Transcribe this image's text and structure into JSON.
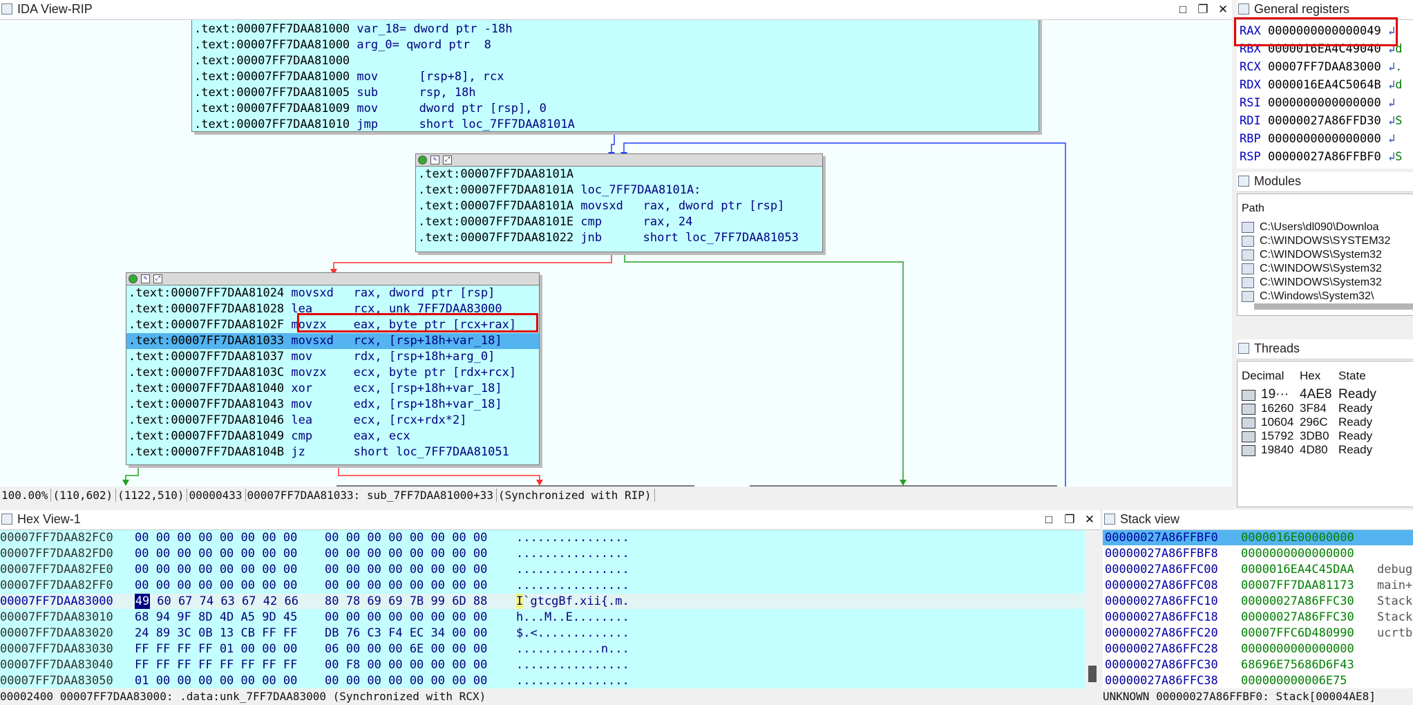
{
  "ida_view": {
    "title": "IDA View-RIP",
    "block_top": [
      {
        "addr": ".text:00007FF7DAA81000",
        "mn": "var_18=",
        "op": "dword ptr -18h"
      },
      {
        "addr": ".text:00007FF7DAA81000",
        "mn": "arg_0=",
        "op": "qword ptr  8"
      },
      {
        "addr": ".text:00007FF7DAA81000",
        "mn": "",
        "op": ""
      },
      {
        "addr": ".text:00007FF7DAA81000",
        "mn": "mov",
        "op": "[rsp+8], rcx"
      },
      {
        "addr": ".text:00007FF7DAA81005",
        "mn": "sub",
        "op": "rsp, 18h"
      },
      {
        "addr": ".text:00007FF7DAA81009",
        "mn": "mov",
        "op": "dword ptr [rsp], 0"
      },
      {
        "addr": ".text:00007FF7DAA81010",
        "mn": "jmp",
        "op": "short loc_7FF7DAA8101A"
      }
    ],
    "block_loop": [
      {
        "addr": ".text:00007FF7DAA8101A",
        "mn": "",
        "op": ""
      },
      {
        "addr": ".text:00007FF7DAA8101A",
        "mn": "loc_7FF7DAA8101A:",
        "op": ""
      },
      {
        "addr": ".text:00007FF7DAA8101A",
        "mn": "movsxd",
        "op": "rax, dword ptr [rsp]"
      },
      {
        "addr": ".text:00007FF7DAA8101E",
        "mn": "cmp",
        "op": "rax, 24"
      },
      {
        "addr": ".text:00007FF7DAA81022",
        "mn": "jnb",
        "op": "short loc_7FF7DAA81053"
      }
    ],
    "block_body": [
      {
        "addr": ".text:00007FF7DAA81024",
        "mn": "movsxd",
        "op": "rax, dword ptr [rsp]"
      },
      {
        "addr": ".text:00007FF7DAA81028",
        "mn": "lea",
        "op": "rcx, unk_7FF7DAA83000"
      },
      {
        "addr": ".text:00007FF7DAA8102F",
        "mn": "movzx",
        "op": "eax, byte ptr [rcx+rax]"
      },
      {
        "addr": ".text:00007FF7DAA81033",
        "mn": "movsxd",
        "op": "rcx, [rsp+18h+var_18]"
      },
      {
        "addr": ".text:00007FF7DAA81037",
        "mn": "mov",
        "op": "rdx, [rsp+18h+arg_0]"
      },
      {
        "addr": ".text:00007FF7DAA8103C",
        "mn": "movzx",
        "op": "ecx, byte ptr [rdx+rcx]"
      },
      {
        "addr": ".text:00007FF7DAA81040",
        "mn": "xor",
        "op": "ecx, [rsp+18h+var_18]"
      },
      {
        "addr": ".text:00007FF7DAA81043",
        "mn": "mov",
        "op": "edx, [rsp+18h+var_18]"
      },
      {
        "addr": ".text:00007FF7DAA81046",
        "mn": "lea",
        "op": "ecx, [rcx+rdx*2]"
      },
      {
        "addr": ".text:00007FF7DAA81049",
        "mn": "cmp",
        "op": "eax, ecx"
      },
      {
        "addr": ".text:00007FF7DAA8104B",
        "mn": "jz",
        "op": "short loc_7FF7DAA81051"
      }
    ],
    "status": [
      "100.00%",
      "(110,602)",
      "(1122,510)",
      "00000433",
      "00007FF7DAA81033: sub_7FF7DAA81000+33",
      "(Synchronized with RIP)"
    ]
  },
  "hex_view": {
    "title": "Hex View-1",
    "rows": [
      {
        "addr": "00007FF7DAA82FC0",
        "b1": "00 00 00 00 00 00 00 00",
        "b2": "00 00 00 00 00 00 00 00",
        "ascii": "................"
      },
      {
        "addr": "00007FF7DAA82FD0",
        "b1": "00 00 00 00 00 00 00 00",
        "b2": "00 00 00 00 00 00 00 00",
        "ascii": "................"
      },
      {
        "addr": "00007FF7DAA82FE0",
        "b1": "00 00 00 00 00 00 00 00",
        "b2": "00 00 00 00 00 00 00 00",
        "ascii": "................"
      },
      {
        "addr": "00007FF7DAA82FF0",
        "b1": "00 00 00 00 00 00 00 00",
        "b2": "00 00 00 00 00 00 00 00",
        "ascii": "................"
      },
      {
        "addr": "00007FF7DAA83000",
        "b1": "49 60 67 74 63 67 42 66",
        "b2": "80 78 69 69 7B 99 6D 88",
        "ascii": "I`gtcgBf.xii{.m."
      },
      {
        "addr": "00007FF7DAA83010",
        "b1": "68 94 9F 8D 4D A5 9D 45",
        "b2": "00 00 00 00 00 00 00 00",
        "ascii": "h...M..E........"
      },
      {
        "addr": "00007FF7DAA83020",
        "b1": "24 89 3C 0B 13 CB FF FF",
        "b2": "DB 76 C3 F4 EC 34 00 00",
        "ascii": "$.<............."
      },
      {
        "addr": "00007FF7DAA83030",
        "b1": "FF FF FF FF 01 00 00 00",
        "b2": "06 00 00 00 6E 00 00 00",
        "ascii": "............n..."
      },
      {
        "addr": "00007FF7DAA83040",
        "b1": "FF FF FF FF FF FF FF FF",
        "b2": "00 F8 00 00 00 00 00 00",
        "ascii": "................"
      },
      {
        "addr": "00007FF7DAA83050",
        "b1": "01 00 00 00 00 00 00 00",
        "b2": "00 00 00 00 00 00 00 00",
        "ascii": "................"
      }
    ],
    "status": "00002400 00007FF7DAA83000: .data:unk_7FF7DAA83000 (Synchronized with RCX)"
  },
  "stack_view": {
    "title": "Stack view",
    "rows": [
      {
        "addr": "00000027A86FFBF0",
        "val": "0000016E00000000",
        "note": ""
      },
      {
        "addr": "00000027A86FFBF8",
        "val": "0000000000000000",
        "note": ""
      },
      {
        "addr": "00000027A86FFC00",
        "val": "0000016EA4C45DAA",
        "note": "debug"
      },
      {
        "addr": "00000027A86FFC08",
        "val": "00007FF7DAA81173",
        "note": "main+"
      },
      {
        "addr": "00000027A86FFC10",
        "val": "00000027A86FFC30",
        "note": "Stack"
      },
      {
        "addr": "00000027A86FFC18",
        "val": "00000027A86FFC30",
        "note": "Stack"
      },
      {
        "addr": "00000027A86FFC20",
        "val": "00007FFC6D480990",
        "note": "ucrtb"
      },
      {
        "addr": "00000027A86FFC28",
        "val": "0000000000000000",
        "note": ""
      },
      {
        "addr": "00000027A86FFC30",
        "val": "68696E75686D6F43",
        "note": ""
      },
      {
        "addr": "00000027A86FFC38",
        "val": "000000000006E75",
        "note": ""
      }
    ],
    "status": "UNKNOWN 00000027A86FFBF0: Stack[00004AE8]"
  },
  "registers": {
    "title": "General registers",
    "rows": [
      {
        "name": "RAX",
        "val": "0000000000000049",
        "tail": ""
      },
      {
        "name": "RBX",
        "val": "0000016EA4C49040",
        "tail": "d"
      },
      {
        "name": "RCX",
        "val": "00007FF7DAA83000",
        "tail": "."
      },
      {
        "name": "RDX",
        "val": "0000016EA4C5064B",
        "tail": "d"
      },
      {
        "name": "RSI",
        "val": "0000000000000000",
        "tail": ""
      },
      {
        "name": "RDI",
        "val": "00000027A86FFD30",
        "tail": "S"
      },
      {
        "name": "RBP",
        "val": "0000000000000000",
        "tail": ""
      },
      {
        "name": "RSP",
        "val": "00000027A86FFBF0",
        "tail": "S"
      }
    ]
  },
  "modules": {
    "title": "Modules",
    "header": "Path",
    "rows": [
      "C:\\Users\\dl090\\Downloa",
      "C:\\WINDOWS\\SYSTEM32",
      "C:\\WINDOWS\\System32",
      "C:\\WINDOWS\\System32",
      "C:\\WINDOWS\\System32",
      "C:\\Windows\\System32\\"
    ]
  },
  "threads": {
    "title": "Threads",
    "headers": [
      "Decimal",
      "Hex",
      "State"
    ],
    "rows": [
      {
        "dec": "19···",
        "hex": "4AE8",
        "state": "Ready"
      },
      {
        "dec": "16260",
        "hex": "3F84",
        "state": "Ready"
      },
      {
        "dec": "10604",
        "hex": "296C",
        "state": "Ready"
      },
      {
        "dec": "15792",
        "hex": "3DB0",
        "state": "Ready"
      },
      {
        "dec": "19840",
        "hex": "4D80",
        "state": "Ready"
      }
    ]
  }
}
